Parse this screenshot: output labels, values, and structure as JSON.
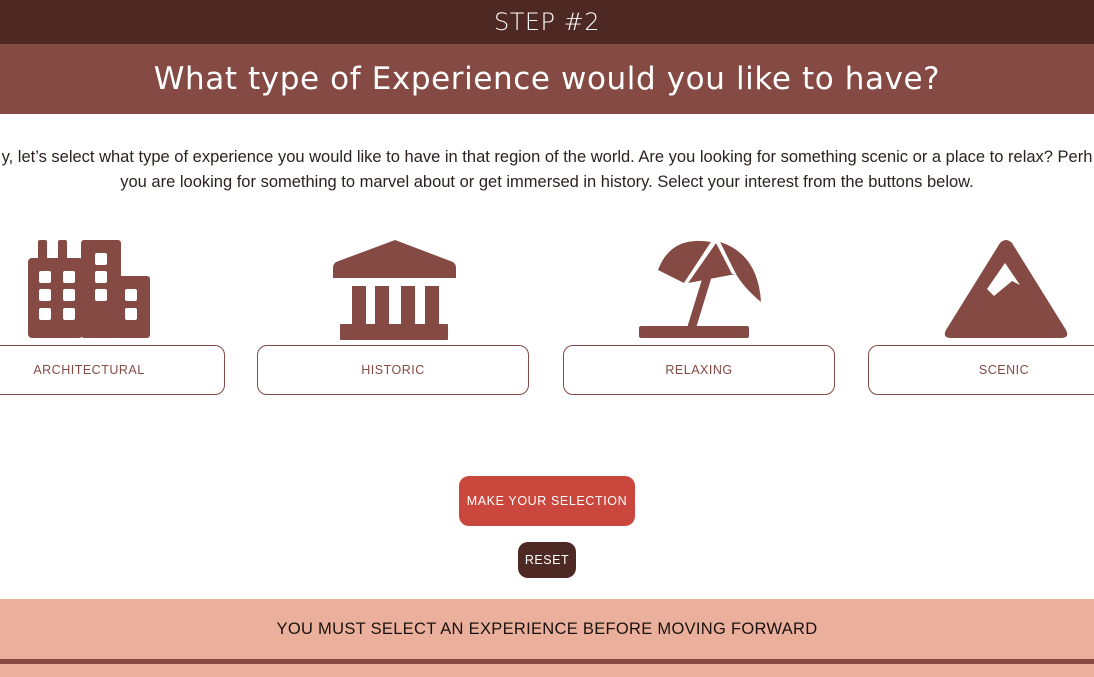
{
  "header": {
    "step_label": "STEP #2",
    "title": "What type of Experience would you like to have?"
  },
  "intro": {
    "line1": "y, let’s select what type of experience you would like to have in that region of the world. Are you looking for something scenic or a place to relax? Perh",
    "line2": "you are looking for something to marvel about or get immersed in history. Select your interest from the buttons below."
  },
  "options": [
    {
      "label": "ARCHITECTURAL",
      "icon": "building-icon"
    },
    {
      "label": "HISTORIC",
      "icon": "museum-icon"
    },
    {
      "label": "RELAXING",
      "icon": "beach-umbrella-icon"
    },
    {
      "label": "SCENIC",
      "icon": "mountain-icon"
    }
  ],
  "actions": {
    "make_selection_label": "MAKE YOUR SELECTION",
    "reset_label": "RESET"
  },
  "warning": {
    "text": "YOU MUST SELECT AN EXPERIENCE BEFORE MOVING FORWARD"
  },
  "colors": {
    "dark_brown": "#4e2823",
    "brown": "#844a43",
    "accent_red": "#c9473c",
    "peach": "#eab09c"
  }
}
